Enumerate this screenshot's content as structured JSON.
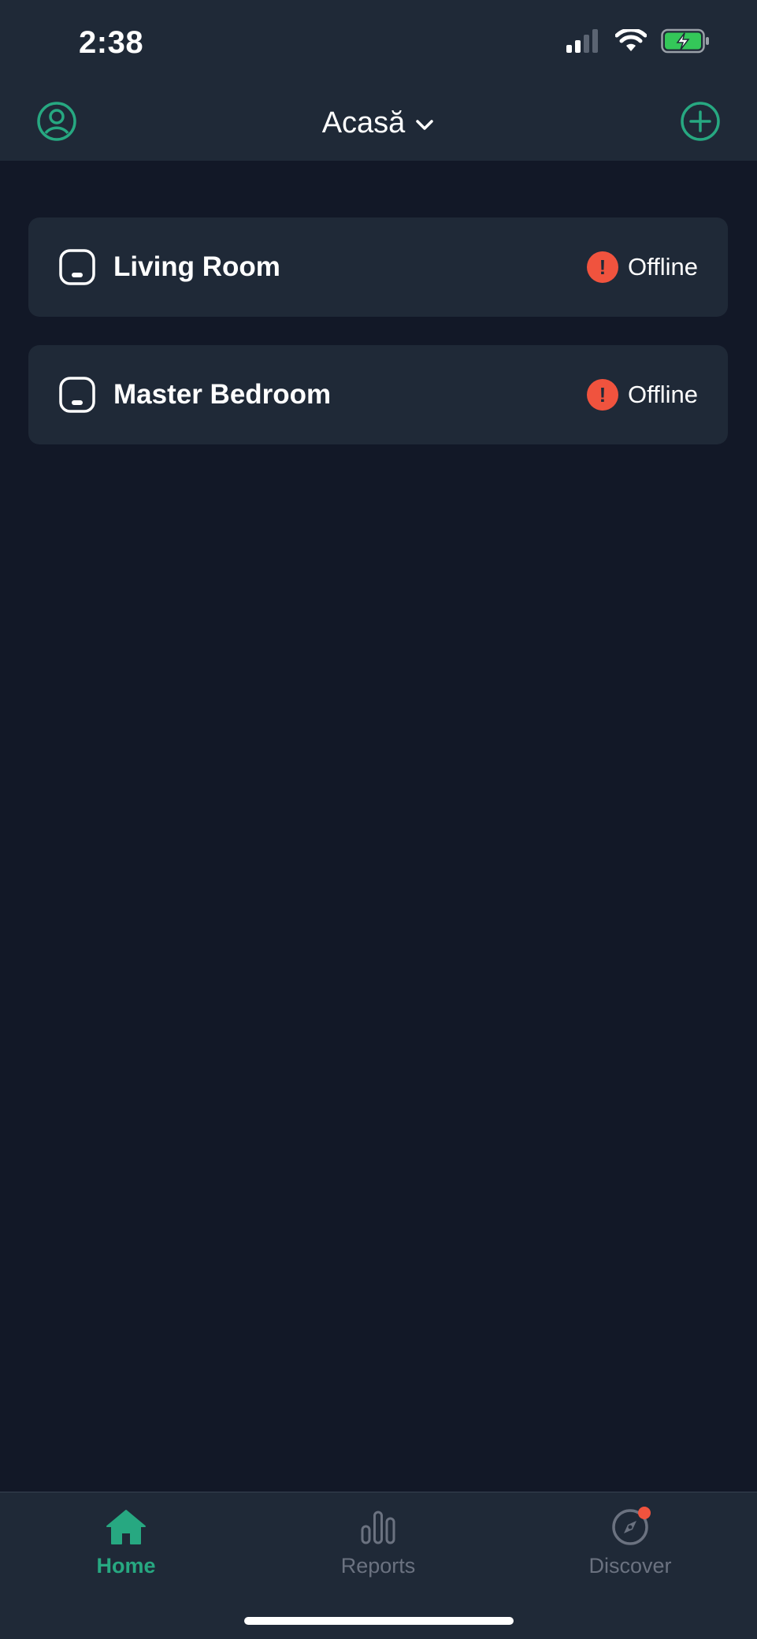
{
  "status_bar": {
    "time": "2:38",
    "icons": [
      "cellular-signal-icon",
      "wifi-icon",
      "battery-charging-icon"
    ]
  },
  "nav": {
    "title": "Acasă",
    "left_icon": "profile-icon",
    "right_icon": "add-circle-icon",
    "title_icon": "chevron-down-icon"
  },
  "rooms": [
    {
      "name": "Living Room",
      "status": "Offline",
      "icon": "thermostat-device-icon",
      "status_icon": "alert-icon"
    },
    {
      "name": "Master Bedroom",
      "status": "Offline",
      "icon": "thermostat-device-icon",
      "status_icon": "alert-icon"
    }
  ],
  "tabs": [
    {
      "label": "Home",
      "icon": "home-icon",
      "active": true
    },
    {
      "label": "Reports",
      "icon": "bar-chart-icon",
      "active": false
    },
    {
      "label": "Discover",
      "icon": "compass-icon",
      "active": false,
      "badge": true
    }
  ],
  "colors": {
    "background": "#121827",
    "surface": "#1f2937",
    "accent": "#27a881",
    "alert": "#f0533e",
    "inactive": "#6b7280"
  }
}
